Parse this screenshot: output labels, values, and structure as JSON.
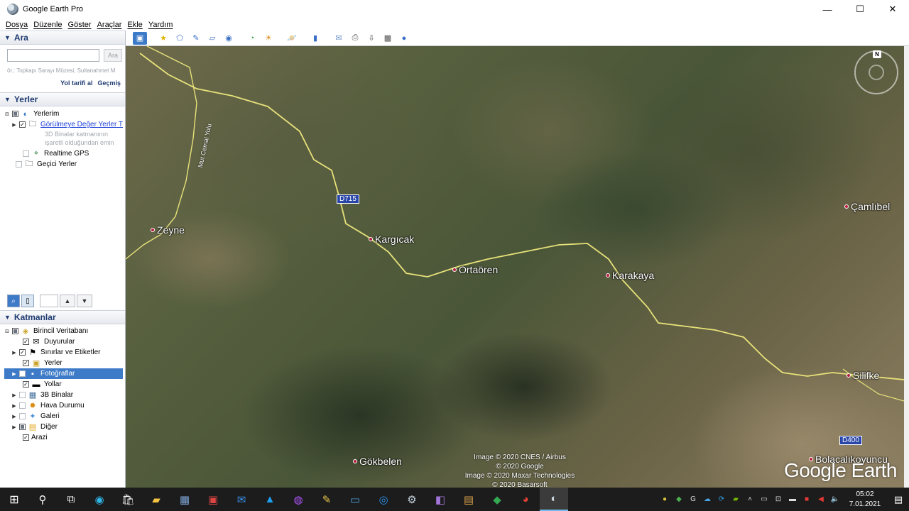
{
  "window": {
    "title": "Google Earth Pro",
    "controls": {
      "minimize": "—",
      "maximize": "☐",
      "close": "✕"
    }
  },
  "menu": [
    "Dosya",
    "Düzenle",
    "Göster",
    "Araçlar",
    "Ekle",
    "Yardım"
  ],
  "search": {
    "header": "Ara",
    "input_value": "",
    "button_label": "Ara",
    "hint": "ör.: Topkapı Sarayı Müzesi, Sultanahmet M",
    "link_directions": "Yol tarifi al",
    "link_history": "Geçmiş"
  },
  "places": {
    "header": "Yerler",
    "items": [
      {
        "label": "Yerlerim"
      },
      {
        "label": "Görülmeye Değer Yerler T"
      },
      {
        "label": "3D Binalar katmanının"
      },
      {
        "label": "işaretli olduğundan emin"
      },
      {
        "label": "Realtime GPS"
      },
      {
        "label": "Geçici Yerler"
      }
    ]
  },
  "layers": {
    "header": "Katmanlar",
    "items": [
      {
        "label": "Birincil Veritabanı"
      },
      {
        "label": "Duyurular"
      },
      {
        "label": "Sınırlar ve Etiketler"
      },
      {
        "label": "Yerler"
      },
      {
        "label": "Fotoğraflar"
      },
      {
        "label": "Yollar"
      },
      {
        "label": "3B Binalar"
      },
      {
        "label": "Hava Durumu"
      },
      {
        "label": "Galeri"
      },
      {
        "label": "Diğer"
      },
      {
        "label": "Arazi"
      }
    ]
  },
  "map": {
    "places": [
      "Zeyne",
      "Kargıcak",
      "Ortaören",
      "Karakaya",
      "Çamlıbel",
      "Silifke",
      "Gökbelen",
      "Bolacalıkoyuncu"
    ],
    "road_shields": [
      "D715",
      "D400"
    ],
    "road_label": "Mut Cemal Yolu",
    "compass_label": "N",
    "attribution": [
      "Image © 2020 CNES / Airbus",
      "© 2020 Google",
      "Image © 2020 Maxar Technologies",
      "© 2020 Basarsoft"
    ],
    "logo": "Google Earth"
  },
  "taskbar": {
    "time": "05:02",
    "date": "7.01.2021"
  },
  "colors": {
    "header_text": "#1f3b72",
    "selection": "#3d7ac7",
    "road": "#e8e27a",
    "link": "#1a3fd6"
  }
}
